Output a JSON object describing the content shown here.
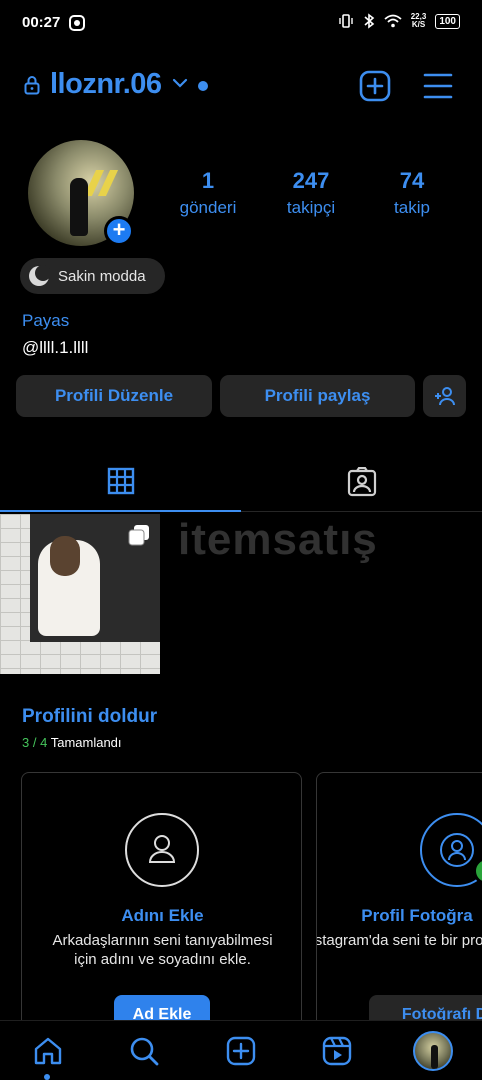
{
  "status_bar": {
    "time": "00:27",
    "speed_value": "22,3",
    "speed_unit": "K/S",
    "battery": "100"
  },
  "header": {
    "username": "lloznr.06"
  },
  "profile": {
    "stats": [
      {
        "value": "1",
        "label": "gönderi"
      },
      {
        "value": "247",
        "label": "takipçi"
      },
      {
        "value": "74",
        "label": "takip"
      }
    ],
    "mood": "Sakin modda",
    "name": "Payas",
    "handle": "@llll.1.llll"
  },
  "actions": {
    "edit_profile": "Profili Düzenle",
    "share_profile": "Profili paylaş"
  },
  "watermark": "itemsatış",
  "complete_profile": {
    "title": "Profilini doldur",
    "progress_done": "3",
    "progress_total": "/ 4",
    "progress_label": "Tamamlandı",
    "cards": [
      {
        "title": "Adını Ekle",
        "description": "Arkadaşlarının seni tanıyabilmesi için adını ve soyadını ekle.",
        "button": "Ad Ekle"
      },
      {
        "title": "Profil Fotoğra",
        "description": "Instagram'da seni te bir profil resm",
        "button": "Fotoğrafı De"
      }
    ]
  },
  "colors": {
    "accent": "#3d8ef0",
    "background": "#000000",
    "button_bg": "#262626",
    "primary_button": "#2f82ec",
    "progress_green": "#45c45b"
  },
  "icons": {
    "header": [
      "lock-icon",
      "chevron-down-icon",
      "new-post-icon",
      "menu-icon"
    ],
    "tabs": [
      "grid-icon",
      "tagged-icon"
    ],
    "nav": [
      "home-icon",
      "search-icon",
      "create-icon",
      "reels-icon",
      "profile-avatar"
    ]
  }
}
